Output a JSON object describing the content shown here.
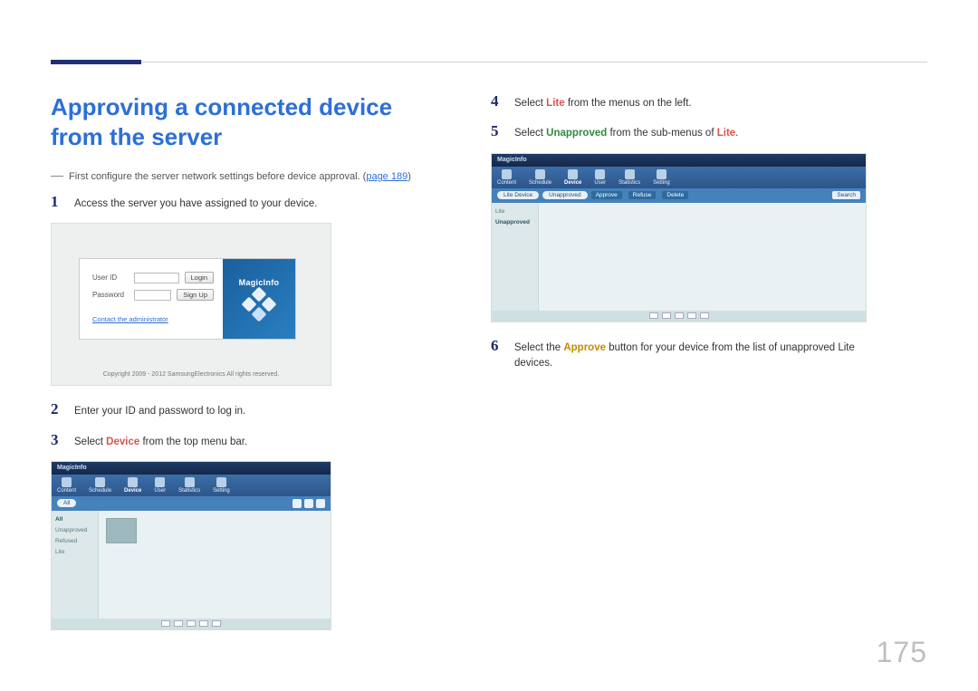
{
  "page_number": "175",
  "heading": "Approving a connected device from the server",
  "intro_note_pre": "First configure the server network settings before device approval. (",
  "intro_link": "page 189",
  "intro_note_post": ")",
  "steps": {
    "s1": {
      "num": "1",
      "text": "Access the server you have assigned to your device."
    },
    "s2": {
      "num": "2",
      "text": "Enter your ID and password to log in."
    },
    "s3": {
      "num": "3",
      "pre": "Select ",
      "kw": "Device",
      "post": " from the top menu bar."
    },
    "s4": {
      "num": "4",
      "pre": "Select ",
      "kw": "Lite",
      "post": " from the menus on the left."
    },
    "s5": {
      "num": "5",
      "pre": "Select ",
      "kw": "Unapproved",
      "post_pre": " from the sub-menus of ",
      "kw2": "Lite",
      "post": "."
    },
    "s6": {
      "num": "6",
      "pre": "Select the ",
      "kw": "Approve",
      "post": " button for your device from the list of unapproved Lite devices."
    }
  },
  "login": {
    "brand": "MagicInfo",
    "user_label": "User ID",
    "pwd_label": "Password",
    "login_btn": "Login",
    "signup_btn": "Sign Up",
    "admin_link": "Contact the administrator",
    "copyright": "Copyright 2009 - 2012 SamsungElectronics All rights reserved."
  },
  "dash": {
    "brand": "MagicInfo",
    "nav": [
      "Content",
      "Schedule",
      "Device",
      "User",
      "Statistics",
      "Setting"
    ],
    "side_a": [
      "All",
      "Unapproved",
      "Refused",
      "Lite"
    ],
    "side_b": [
      "Lite Device",
      "Unapproved"
    ],
    "sub_btns": [
      "Approve",
      "Refuse",
      "Delete"
    ],
    "search": "Search"
  }
}
